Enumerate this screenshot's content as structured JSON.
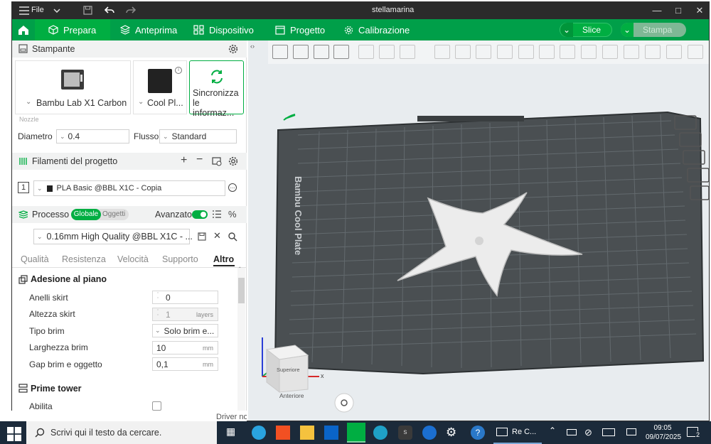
{
  "window": {
    "title": "stellamarina",
    "file_menu": "File"
  },
  "menubar": {
    "tabs": [
      {
        "label": "Prepara"
      },
      {
        "label": "Anteprima"
      },
      {
        "label": "Dispositivo"
      },
      {
        "label": "Progetto"
      },
      {
        "label": "Calibrazione"
      }
    ],
    "slice_label": "Slice",
    "print_label": "Stampa"
  },
  "printer": {
    "section_title": "Stampante",
    "printer_name": "Bambu Lab X1 Carbon",
    "plate_name": "Cool Pl...",
    "sync_label_1": "Sincronizza",
    "sync_label_2": "le informaz...",
    "nozzle_caption": "Nozzle",
    "diameter_label": "Diametro",
    "diameter_value": "0.4",
    "flow_label": "Flusso",
    "flow_value": "Standard"
  },
  "filaments": {
    "section_title": "Filamenti del progetto",
    "items": [
      {
        "index": "1",
        "name": "PLA Basic @BBL X1C - Copia"
      }
    ]
  },
  "process": {
    "section_title": "Processo",
    "toggle_global": "Globale",
    "toggle_objects": "Oggetti",
    "advanced_label": "Avanzato",
    "preset": "0.16mm High Quality @BBL X1C - ...",
    "tabs": [
      "Qualità",
      "Resistenza",
      "Velocità",
      "Supporto",
      "Altro"
    ],
    "active_tab": "Altro"
  },
  "settings": {
    "bed_adhesion_title": "Adesione al piano",
    "skirt_loops_label": "Anelli skirt",
    "skirt_loops_value": "0",
    "skirt_height_label": "Altezza skirt",
    "skirt_height_value": "1",
    "skirt_height_unit": "layers",
    "brim_type_label": "Tipo brim",
    "brim_type_value": "Solo brim e...",
    "brim_width_label": "Larghezza brim",
    "brim_width_value": "10",
    "brim_width_unit": "mm",
    "brim_gap_label": "Gap brim e oggetto",
    "brim_gap_value": "0,1",
    "brim_gap_unit": "mm",
    "prime_tower_title": "Prime tower",
    "enable_label": "Abilita"
  },
  "viewport": {
    "plate_text": "Bambu Cool Plate",
    "cube_top": "Superiore",
    "cube_front": "Anteriore",
    "axis_x": "x"
  },
  "behind_text": "Driver non disponibile",
  "taskbar": {
    "search_placeholder": "Scrivi qui il testo da cercare.",
    "app_label": "Re C...",
    "time": "09:05",
    "date": "09/07/2025",
    "notifications": "2"
  },
  "colors": {
    "brand_green": "#00ae42",
    "menubar_green": "#009f49",
    "titlebar": "#2b2b2b",
    "taskbar": "#1b2a3a",
    "plate": "#4a4f52"
  }
}
